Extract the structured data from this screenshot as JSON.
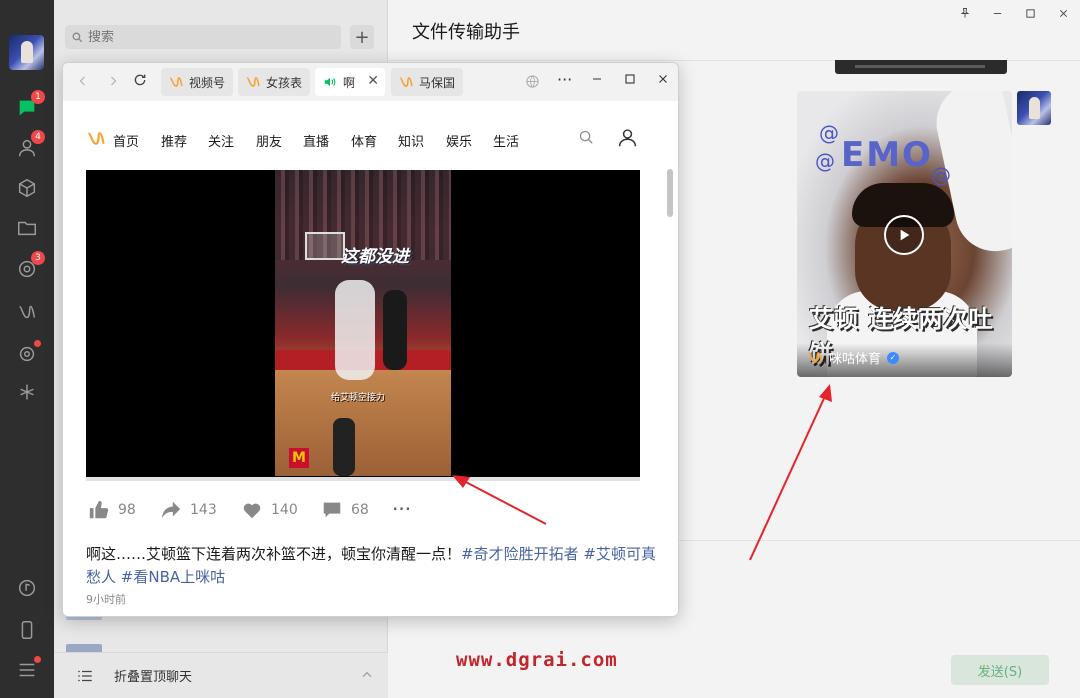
{
  "sidebar": {
    "badges": {
      "chat": "1",
      "contacts": "4",
      "moments": "3"
    }
  },
  "chat_list": {
    "search_placeholder": "搜索",
    "add_label": "+",
    "footer_label": "折叠置顶聊天"
  },
  "chat": {
    "title": "文件传输助手",
    "send_label": "发送(S)",
    "card": {
      "emo_text": "EMO",
      "caption": "艾顿 连续两次吐饼",
      "channel": "咪咕体育"
    }
  },
  "browser": {
    "tabs": [
      {
        "label": "视频号"
      },
      {
        "label": "女孩表"
      },
      {
        "label": "啊"
      },
      {
        "label": "马保国"
      }
    ],
    "nav": [
      "首页",
      "推荐",
      "关注",
      "朋友",
      "直播",
      "体育",
      "知识",
      "娱乐",
      "生活"
    ],
    "video": {
      "caption_top": "这都没进",
      "caption_bottom": "给艾顿空接力",
      "progress": 0
    },
    "actions": {
      "likes": "98",
      "shares": "143",
      "hearts": "140",
      "comments": "68"
    },
    "description": {
      "text": "啊这……艾顿篮下连着两次补篮不进，顿宝你清醒一点！",
      "tag1": "#奇才险胜开拓者",
      "tag2": "#艾顿可真愁人",
      "tag3": "#看NBA上咪咕"
    },
    "time": "9小时前"
  },
  "watermark": "www.dgrai.com",
  "colors": {
    "accent_green": "#07c160",
    "badge_red": "#f04848",
    "watermark_red": "#c0262c",
    "tag_blue": "#4863a0"
  }
}
